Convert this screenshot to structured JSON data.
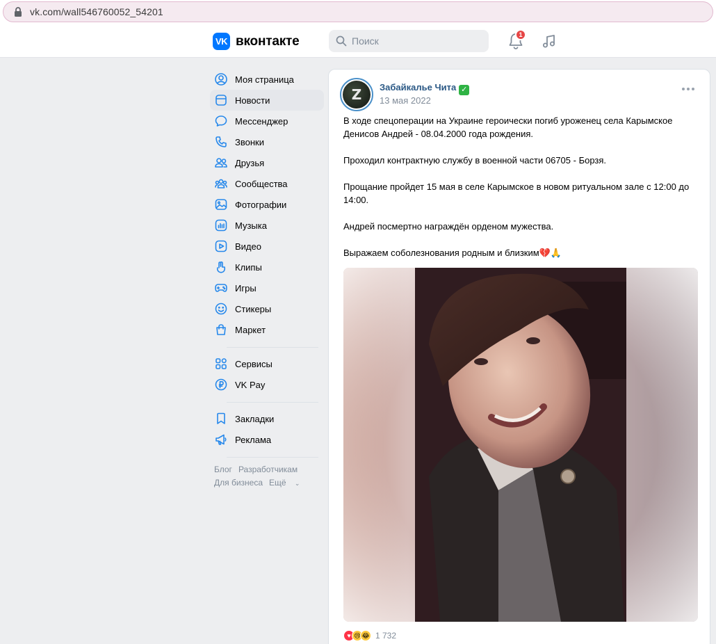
{
  "browser": {
    "url": "vk.com/wall546760052_54201"
  },
  "header": {
    "logo_text": "вконтакте",
    "logo_mark": "VK",
    "search_placeholder": "Поиск",
    "notifications_count": "1",
    "brand_color": "#0077ff"
  },
  "sidebar": {
    "items": [
      {
        "label": "Моя страница",
        "icon": "user-circle-icon"
      },
      {
        "label": "Новости",
        "icon": "news-icon",
        "active": true
      },
      {
        "label": "Мессенджер",
        "icon": "message-icon"
      },
      {
        "label": "Звонки",
        "icon": "phone-icon"
      },
      {
        "label": "Друзья",
        "icon": "friends-icon"
      },
      {
        "label": "Сообщества",
        "icon": "communities-icon"
      },
      {
        "label": "Фотографии",
        "icon": "photo-icon"
      },
      {
        "label": "Музыка",
        "icon": "music-icon"
      },
      {
        "label": "Видео",
        "icon": "video-icon"
      },
      {
        "label": "Клипы",
        "icon": "clips-icon"
      },
      {
        "label": "Игры",
        "icon": "games-icon"
      },
      {
        "label": "Стикеры",
        "icon": "stickers-icon"
      },
      {
        "label": "Маркет",
        "icon": "market-icon"
      }
    ],
    "items2": [
      {
        "label": "Сервисы",
        "icon": "services-icon"
      },
      {
        "label": "VK Pay",
        "icon": "vkpay-icon"
      }
    ],
    "items3": [
      {
        "label": "Закладки",
        "icon": "bookmark-icon"
      },
      {
        "label": "Реклама",
        "icon": "ads-icon"
      }
    ],
    "footer": {
      "blog": "Блог",
      "developers": "Разработчикам",
      "business": "Для бизнеса",
      "more": "Ещё"
    }
  },
  "post": {
    "author": "Забайкалье Чита",
    "verified_mark": "✓",
    "date": "13 мая 2022",
    "avatar_letter": "Z",
    "paragraphs": [
      "В ходе спецоперации на Украине героически погиб уроженец села Карымское Денисов Андрей - 08.04.2000 года рождения.",
      "Проходил контрактную службу в военной части 06705 - Борзя.",
      "Прощание пройдет 15 мая в селе Карымское в новом ритуальном зале с 12:00 до 14:00.",
      "Андрей посмертно награждён орденом мужества.",
      "Выражаем соболезнования родным и близким💔🙏"
    ],
    "reactions_count": "1 732",
    "reaction_icons": [
      "heart-icon",
      "sad-icon",
      "laugh-icon"
    ]
  }
}
